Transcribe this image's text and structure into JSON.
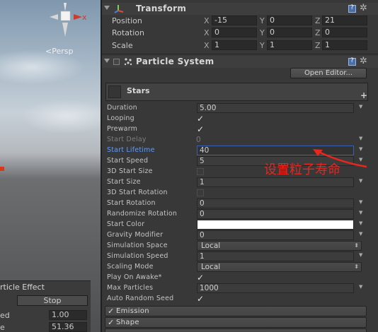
{
  "scene": {
    "persp_label": "<Persp",
    "effect_panel": {
      "title": "rticle Effect",
      "stop_label": "Stop",
      "rows": [
        {
          "label": "ed",
          "value": "1.00"
        },
        {
          "label": "e",
          "value": "51.36"
        }
      ]
    }
  },
  "transform": {
    "title": "Transform",
    "rows": [
      {
        "label": "Position",
        "x": "-15",
        "y": "0",
        "z": "21"
      },
      {
        "label": "Rotation",
        "x": "0",
        "y": "0",
        "z": "0"
      },
      {
        "label": "Scale",
        "x": "1",
        "y": "1",
        "z": "1"
      }
    ],
    "axes": [
      "X",
      "Y",
      "Z"
    ]
  },
  "particle_system": {
    "title": "Particle System",
    "open_editor_label": "Open Editor...",
    "system_name": "Stars",
    "plus_label": "+",
    "rows": [
      {
        "label": "Duration",
        "kind": "field",
        "value": "5.00"
      },
      {
        "label": "Looping",
        "kind": "check",
        "value": "✓"
      },
      {
        "label": "Prewarm",
        "kind": "check",
        "value": "✓"
      },
      {
        "label": "Start Delay",
        "kind": "dim",
        "value": "0"
      },
      {
        "label": "Start Lifetime",
        "kind": "active",
        "value": "40"
      },
      {
        "label": "Start Speed",
        "kind": "field",
        "value": "5"
      },
      {
        "label": "3D Start Size",
        "kind": "empty",
        "value": ""
      },
      {
        "label": "Start Size",
        "kind": "field",
        "value": "1"
      },
      {
        "label": "3D Start Rotation",
        "kind": "empty",
        "value": ""
      },
      {
        "label": "Start Rotation",
        "kind": "field",
        "value": "0"
      },
      {
        "label": "Randomize Rotation",
        "kind": "field",
        "value": "0"
      },
      {
        "label": "Start Color",
        "kind": "color",
        "value": ""
      },
      {
        "label": "Gravity Modifier",
        "kind": "field",
        "value": "0"
      },
      {
        "label": "Simulation Space",
        "kind": "enum",
        "value": "Local"
      },
      {
        "label": "Simulation Speed",
        "kind": "field",
        "value": "1"
      },
      {
        "label": "Scaling Mode",
        "kind": "enum",
        "value": "Local"
      },
      {
        "label": "Play On Awake*",
        "kind": "check",
        "value": "✓"
      },
      {
        "label": "Max Particles",
        "kind": "field",
        "value": "1000"
      },
      {
        "label": "Auto Random Seed",
        "kind": "check",
        "value": "✓"
      }
    ],
    "modules": [
      {
        "label": "Emission",
        "check": "✓"
      },
      {
        "label": "Shape",
        "check": "✓"
      }
    ]
  },
  "annotation": {
    "text": "设置粒子寿命",
    "color": "#e8261e"
  },
  "colors": {
    "inspector_bg": "#383838",
    "focus_blue": "#5b9bff"
  }
}
